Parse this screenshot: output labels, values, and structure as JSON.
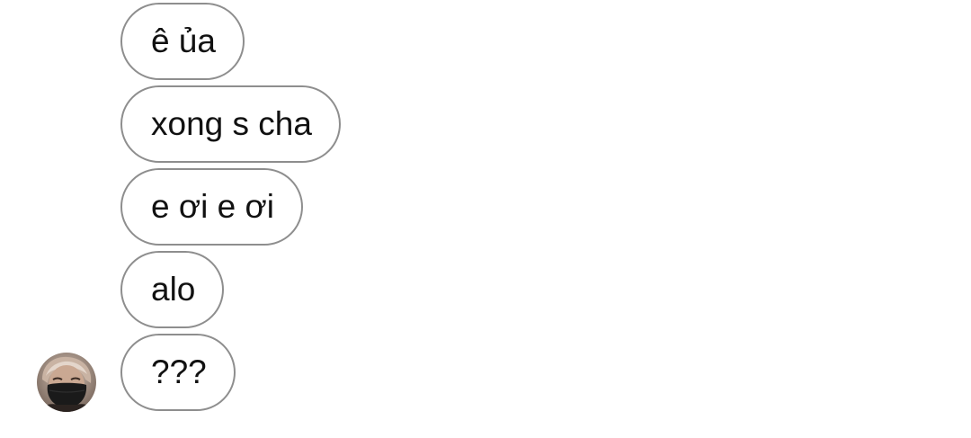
{
  "messages": [
    {
      "text": "ê ủa"
    },
    {
      "text": "xong s cha"
    },
    {
      "text": "e ơi e ơi"
    },
    {
      "text": "alo"
    },
    {
      "text": "???"
    }
  ],
  "sender": {
    "avatar_icon": "masked-person-avatar"
  },
  "colors": {
    "bubble_border": "#8e8e8e",
    "bubble_text": "#111111",
    "background": "#ffffff"
  }
}
